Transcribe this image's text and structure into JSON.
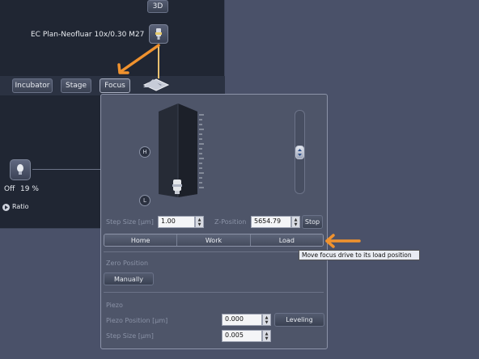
{
  "left_panel": {
    "btn_3d": "3D",
    "objective_label": "EC Plan-Neofluar 10x/0.30 M27",
    "tabs": [
      "Incubator",
      "Stage",
      "Focus"
    ],
    "lamp_status": "Off",
    "lamp_value": "19 %",
    "ratio_label": "Ratio"
  },
  "focus_popup": {
    "h_label": "H",
    "l_label": "L",
    "step_size_label": "Step Size [µm]",
    "step_size_value": "1.00",
    "z_position_label": "Z-Position",
    "z_position_value": "5654.79",
    "stop_label": "Stop",
    "positions": [
      "Home",
      "Work",
      "Load"
    ],
    "zero_position_heading": "Zero Position",
    "manually_label": "Manually",
    "piezo_heading": "Piezo",
    "piezo_position_label": "Piezo Position [µm]",
    "piezo_position_value": "0.000",
    "leveling_label": "Leveling",
    "piezo_step_label": "Step Size [µm]",
    "piezo_step_value": "0.005"
  },
  "tooltip": {
    "text": "Move focus drive to its load position"
  },
  "colors": {
    "annotation_arrow": "#f0922e",
    "popup_bg": "#4e5569"
  }
}
